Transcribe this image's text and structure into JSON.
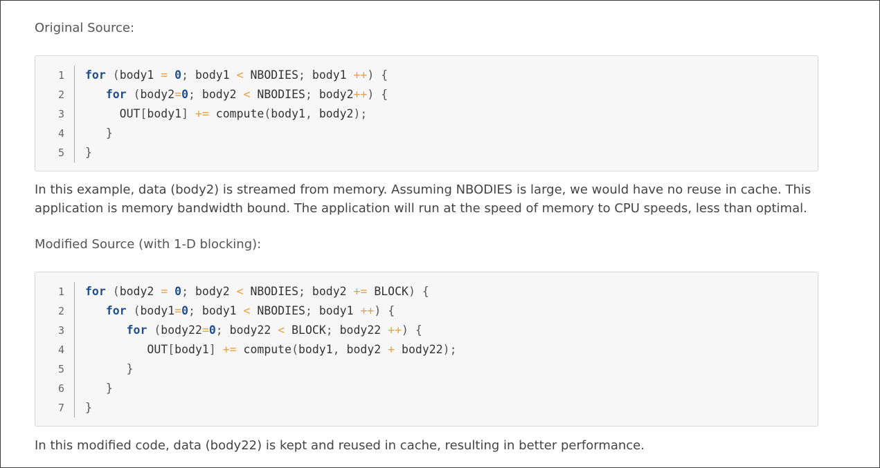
{
  "sections": {
    "original_heading": "Original Source:",
    "original_paragraph": "In this example, data (body2) is streamed from memory. Assuming NBODIES is large, we would have no reuse in cache. This application is memory bandwidth bound. The application will run at the speed of memory to CPU speeds, less than optimal.",
    "modified_heading": "Modified Source (with 1-D blocking):",
    "modified_paragraph": "In this modified code, data (body22) is kept and reused in cache, resulting in better performance."
  },
  "code_blocks": [
    {
      "line_numbers": [
        "1",
        "2",
        "3",
        "4",
        "5"
      ],
      "lines": [
        [
          [
            "keyword",
            "for"
          ],
          [
            "ws",
            " "
          ],
          [
            "punct",
            "("
          ],
          [
            "ident",
            "body1"
          ],
          [
            "ws",
            " "
          ],
          [
            "op",
            "="
          ],
          [
            "ws",
            " "
          ],
          [
            "number",
            "0"
          ],
          [
            "punct",
            ";"
          ],
          [
            "ws",
            " "
          ],
          [
            "ident",
            "body1"
          ],
          [
            "ws",
            " "
          ],
          [
            "op",
            "<"
          ],
          [
            "ws",
            " "
          ],
          [
            "ident",
            "NBODIES"
          ],
          [
            "punct",
            ";"
          ],
          [
            "ws",
            " "
          ],
          [
            "ident",
            "body1"
          ],
          [
            "ws",
            " "
          ],
          [
            "op",
            "++"
          ],
          [
            "punct",
            ")"
          ],
          [
            "ws",
            " "
          ],
          [
            "punct",
            "{"
          ]
        ],
        [
          [
            "ws",
            "   "
          ],
          [
            "keyword",
            "for"
          ],
          [
            "ws",
            " "
          ],
          [
            "punct",
            "("
          ],
          [
            "ident",
            "body2"
          ],
          [
            "op",
            "="
          ],
          [
            "number",
            "0"
          ],
          [
            "punct",
            ";"
          ],
          [
            "ws",
            " "
          ],
          [
            "ident",
            "body2"
          ],
          [
            "ws",
            " "
          ],
          [
            "op",
            "<"
          ],
          [
            "ws",
            " "
          ],
          [
            "ident",
            "NBODIES"
          ],
          [
            "punct",
            ";"
          ],
          [
            "ws",
            " "
          ],
          [
            "ident",
            "body2"
          ],
          [
            "op",
            "++"
          ],
          [
            "punct",
            ")"
          ],
          [
            "ws",
            " "
          ],
          [
            "punct",
            "{"
          ]
        ],
        [
          [
            "ws",
            "     "
          ],
          [
            "ident",
            "OUT"
          ],
          [
            "punct",
            "["
          ],
          [
            "ident",
            "body1"
          ],
          [
            "punct",
            "]"
          ],
          [
            "ws",
            " "
          ],
          [
            "op",
            "+="
          ],
          [
            "ws",
            " "
          ],
          [
            "ident",
            "compute"
          ],
          [
            "punct",
            "("
          ],
          [
            "ident",
            "body1"
          ],
          [
            "punct",
            ","
          ],
          [
            "ws",
            " "
          ],
          [
            "ident",
            "body2"
          ],
          [
            "punct",
            ");"
          ]
        ],
        [
          [
            "ws",
            "   "
          ],
          [
            "punct",
            "}"
          ]
        ],
        [
          [
            "punct",
            "}"
          ]
        ]
      ]
    },
    {
      "line_numbers": [
        "1",
        "2",
        "3",
        "4",
        "5",
        "6",
        "7"
      ],
      "lines": [
        [
          [
            "keyword",
            "for"
          ],
          [
            "ws",
            " "
          ],
          [
            "punct",
            "("
          ],
          [
            "ident",
            "body2"
          ],
          [
            "ws",
            " "
          ],
          [
            "op",
            "="
          ],
          [
            "ws",
            " "
          ],
          [
            "number",
            "0"
          ],
          [
            "punct",
            ";"
          ],
          [
            "ws",
            " "
          ],
          [
            "ident",
            "body2"
          ],
          [
            "ws",
            " "
          ],
          [
            "op",
            "<"
          ],
          [
            "ws",
            " "
          ],
          [
            "ident",
            "NBODIES"
          ],
          [
            "punct",
            ";"
          ],
          [
            "ws",
            " "
          ],
          [
            "ident",
            "body2"
          ],
          [
            "ws",
            " "
          ],
          [
            "op",
            "+="
          ],
          [
            "ws",
            " "
          ],
          [
            "ident",
            "BLOCK"
          ],
          [
            "punct",
            ")"
          ],
          [
            "ws",
            " "
          ],
          [
            "punct",
            "{"
          ]
        ],
        [
          [
            "ws",
            "   "
          ],
          [
            "keyword",
            "for"
          ],
          [
            "ws",
            " "
          ],
          [
            "punct",
            "("
          ],
          [
            "ident",
            "body1"
          ],
          [
            "op",
            "="
          ],
          [
            "number",
            "0"
          ],
          [
            "punct",
            ";"
          ],
          [
            "ws",
            " "
          ],
          [
            "ident",
            "body1"
          ],
          [
            "ws",
            " "
          ],
          [
            "op",
            "<"
          ],
          [
            "ws",
            " "
          ],
          [
            "ident",
            "NBODIES"
          ],
          [
            "punct",
            ";"
          ],
          [
            "ws",
            " "
          ],
          [
            "ident",
            "body1"
          ],
          [
            "ws",
            " "
          ],
          [
            "op",
            "++"
          ],
          [
            "punct",
            ")"
          ],
          [
            "ws",
            " "
          ],
          [
            "punct",
            "{"
          ]
        ],
        [
          [
            "ws",
            "      "
          ],
          [
            "keyword",
            "for"
          ],
          [
            "ws",
            " "
          ],
          [
            "punct",
            "("
          ],
          [
            "ident",
            "body22"
          ],
          [
            "op",
            "="
          ],
          [
            "number",
            "0"
          ],
          [
            "punct",
            ";"
          ],
          [
            "ws",
            " "
          ],
          [
            "ident",
            "body22"
          ],
          [
            "ws",
            " "
          ],
          [
            "op",
            "<"
          ],
          [
            "ws",
            " "
          ],
          [
            "ident",
            "BLOCK"
          ],
          [
            "punct",
            ";"
          ],
          [
            "ws",
            " "
          ],
          [
            "ident",
            "body22"
          ],
          [
            "ws",
            " "
          ],
          [
            "op",
            "++"
          ],
          [
            "punct",
            ")"
          ],
          [
            "ws",
            " "
          ],
          [
            "punct",
            "{"
          ]
        ],
        [
          [
            "ws",
            "         "
          ],
          [
            "ident",
            "OUT"
          ],
          [
            "punct",
            "["
          ],
          [
            "ident",
            "body1"
          ],
          [
            "punct",
            "]"
          ],
          [
            "ws",
            " "
          ],
          [
            "op",
            "+="
          ],
          [
            "ws",
            " "
          ],
          [
            "ident",
            "compute"
          ],
          [
            "punct",
            "("
          ],
          [
            "ident",
            "body1"
          ],
          [
            "punct",
            ","
          ],
          [
            "ws",
            " "
          ],
          [
            "ident",
            "body2"
          ],
          [
            "ws",
            " "
          ],
          [
            "op",
            "+"
          ],
          [
            "ws",
            " "
          ],
          [
            "ident",
            "body22"
          ],
          [
            "punct",
            ");"
          ]
        ],
        [
          [
            "ws",
            "      "
          ],
          [
            "punct",
            "}"
          ]
        ],
        [
          [
            "ws",
            "   "
          ],
          [
            "punct",
            "}"
          ]
        ],
        [
          [
            "punct",
            "}"
          ]
        ]
      ]
    }
  ],
  "colors": {
    "keyword": "#1f4f8f",
    "operator": "#e8a040",
    "code_background": "#f7f7f7",
    "text": "#444444"
  }
}
